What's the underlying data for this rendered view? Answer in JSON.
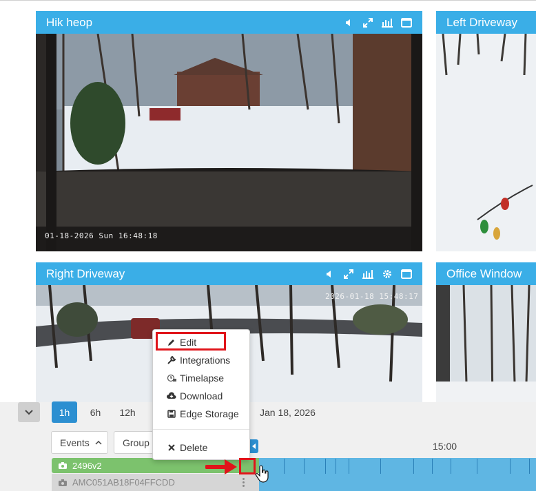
{
  "tiles": [
    {
      "id": "hik",
      "title": "Hik heop",
      "timestamp": "01-18-2026 Sun 16:48:18"
    },
    {
      "id": "left",
      "title": "Left Driveway"
    },
    {
      "id": "right",
      "title": "Right Driveway",
      "timestamp": "2026-01-18 15:48:17"
    },
    {
      "id": "office",
      "title": "Office Window"
    }
  ],
  "context_menu": {
    "items": [
      {
        "label": "Edit",
        "icon": "pencil-icon"
      },
      {
        "label": "Integrations",
        "icon": "wrench-icon"
      },
      {
        "label": "Timelapse",
        "icon": "timelapse-icon"
      },
      {
        "label": "Download",
        "icon": "cloud-download-icon"
      },
      {
        "label": "Edge Storage",
        "icon": "floppy-disk-icon"
      },
      {
        "label": "Delete",
        "icon": "x-icon"
      }
    ]
  },
  "timeline": {
    "ranges": [
      "1h",
      "6h",
      "12h"
    ],
    "active_range": "1h",
    "date": "Jan 18, 2026",
    "time_label": "15:00",
    "events_dropdown": "Events",
    "group_dropdown": "Group",
    "cameras": [
      {
        "label": "2496v2",
        "active": true
      },
      {
        "label": "AMC051AB18F04FFCDD",
        "active": false
      }
    ]
  },
  "colors": {
    "header_blue": "#3aaee7",
    "active_range_blue": "#2c8fd1",
    "camera_row_green": "#7cc26d",
    "annotation_red": "#e0141a",
    "track_blue": "#5fb6e3"
  }
}
